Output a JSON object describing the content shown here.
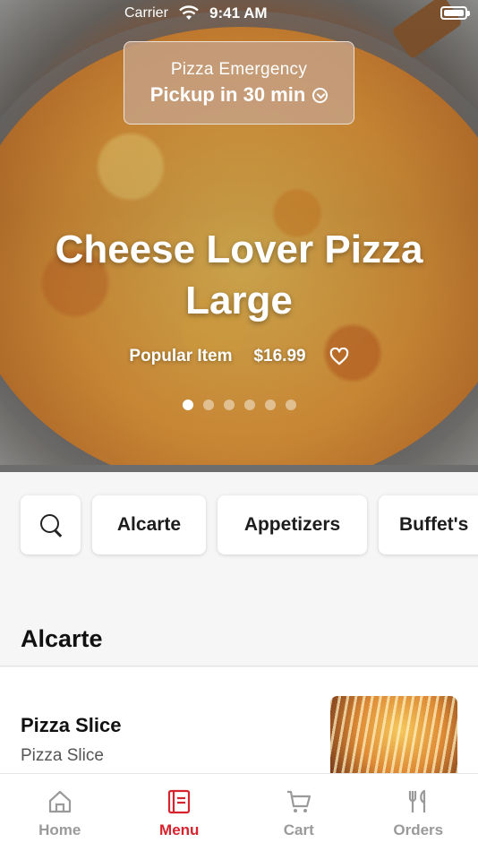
{
  "status_bar": {
    "carrier": "Carrier",
    "time": "9:41 AM"
  },
  "banner": {
    "title": "Pizza Emergency",
    "subtitle": "Pickup in 30 min"
  },
  "featured": {
    "title_line1": "Cheese Lover Pizza",
    "title_line2": "Large",
    "tag": "Popular Item",
    "price": "$16.99",
    "slide_count": 6,
    "active_slide": 1
  },
  "categories": [
    "Alcarte",
    "Appetizers",
    "Buffet's"
  ],
  "section": {
    "title": "Alcarte",
    "items": [
      {
        "name": "Pizza Slice",
        "description": "Pizza Slice"
      }
    ]
  },
  "tabbar": {
    "tabs": [
      {
        "label": "Home",
        "icon": "home-icon",
        "active": false
      },
      {
        "label": "Menu",
        "icon": "menu-icon",
        "active": true
      },
      {
        "label": "Cart",
        "icon": "cart-icon",
        "active": false
      },
      {
        "label": "Orders",
        "icon": "fork-knife-icon",
        "active": false
      }
    ]
  },
  "colors": {
    "accent": "#d6232e",
    "inactive_tab": "#9a9a9a",
    "banner_bg": "#c4a082"
  }
}
